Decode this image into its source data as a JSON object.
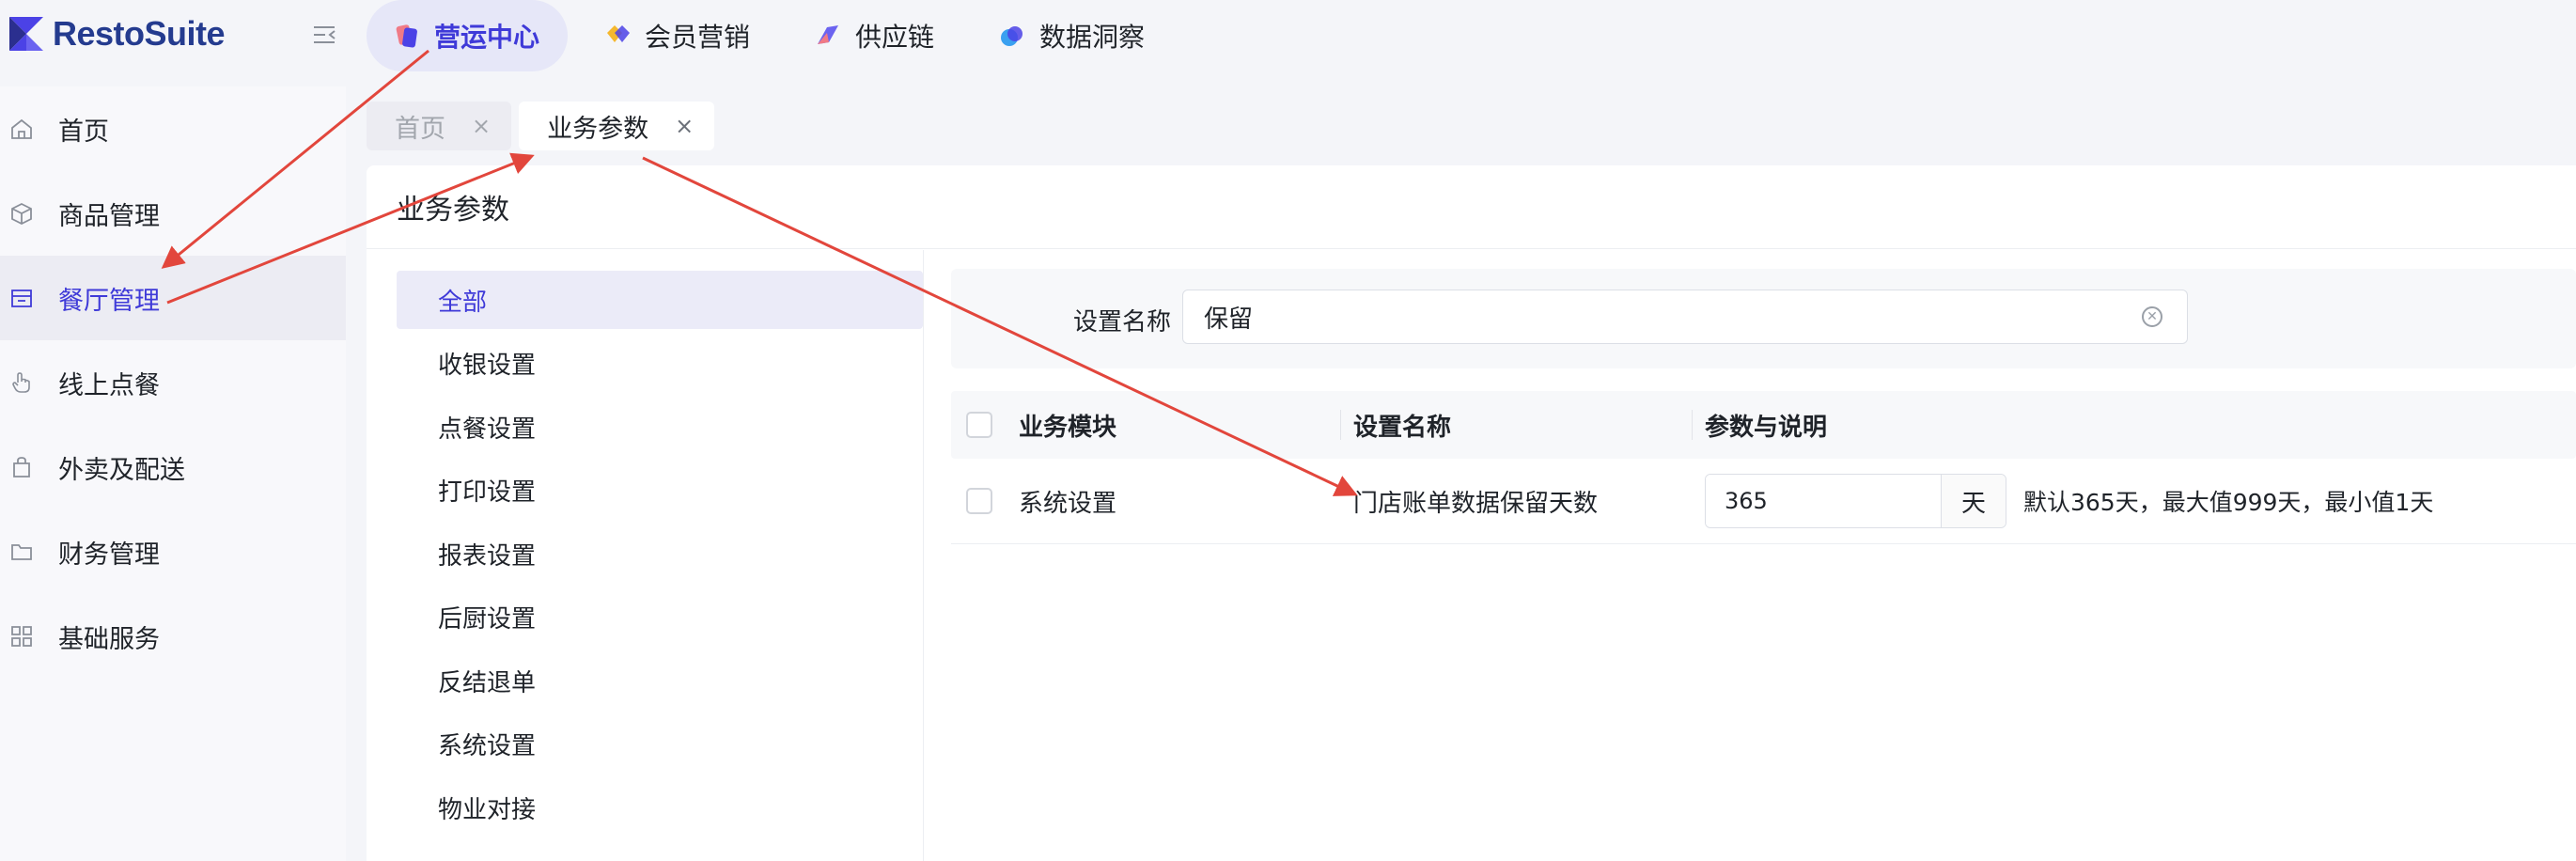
{
  "app": {
    "logo_text": "RestoSuite"
  },
  "topnav": [
    {
      "label": "营运中心",
      "active": true,
      "icon": "operations-icon"
    },
    {
      "label": "会员营销",
      "active": false,
      "icon": "membership-icon"
    },
    {
      "label": "供应链",
      "active": false,
      "icon": "supply-chain-icon"
    },
    {
      "label": "数据洞察",
      "active": false,
      "icon": "data-insight-icon"
    }
  ],
  "sidebar": {
    "items": [
      {
        "label": "首页",
        "icon": "home-icon"
      },
      {
        "label": "商品管理",
        "icon": "box-icon"
      },
      {
        "label": "餐厅管理",
        "icon": "store-icon",
        "active": true
      },
      {
        "label": "线上点餐",
        "icon": "hand-pointer-icon"
      },
      {
        "label": "外卖及配送",
        "icon": "shopping-bag-icon"
      },
      {
        "label": "财务管理",
        "icon": "folder-icon"
      },
      {
        "label": "基础服务",
        "icon": "grid-icon"
      }
    ]
  },
  "tabs": [
    {
      "label": "首页",
      "close": "×",
      "active": false
    },
    {
      "label": "业务参数",
      "close": "×",
      "active": true
    }
  ],
  "page": {
    "title": "业务参数"
  },
  "categories": [
    {
      "label": "全部",
      "active": true
    },
    {
      "label": "收银设置"
    },
    {
      "label": "点餐设置"
    },
    {
      "label": "打印设置"
    },
    {
      "label": "报表设置"
    },
    {
      "label": "后厨设置"
    },
    {
      "label": "反结退单"
    },
    {
      "label": "系统设置"
    },
    {
      "label": "物业对接"
    }
  ],
  "filter": {
    "label": "设置名称",
    "value": "保留"
  },
  "table": {
    "headers": {
      "module": "业务模块",
      "name": "设置名称",
      "param": "参数与说明"
    },
    "rows": [
      {
        "module": "系统设置",
        "name": "门店账单数据保留天数",
        "value": "365",
        "unit": "天",
        "description": "默认365天，最大值999天，最小值1天"
      }
    ]
  },
  "colors": {
    "accent": "#3f3ad8",
    "annotation_arrow": "#e2463c"
  }
}
